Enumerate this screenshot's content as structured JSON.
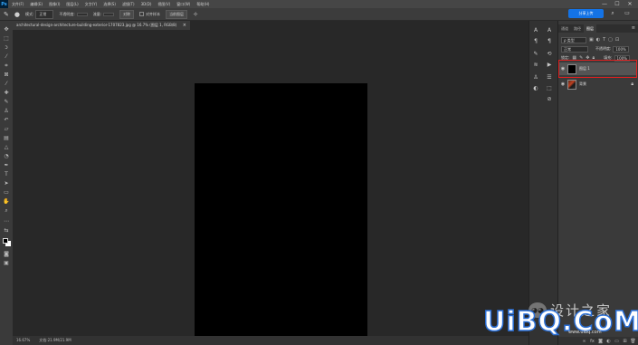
{
  "app": {
    "logo": "Ps",
    "menus": [
      "文件(F)",
      "编辑(E)",
      "图像(I)",
      "图层(L)",
      "文字(Y)",
      "选择(S)",
      "滤镜(T)",
      "3D(D)",
      "视图(V)",
      "窗口(W)",
      "帮助(H)"
    ],
    "window_controls": [
      "—",
      "☐",
      "✕"
    ]
  },
  "options_bar": {
    "mode_label": "模式:",
    "mode_value": "正常",
    "opacity_label": "不透明度:",
    "flow_label": "流量:",
    "symmetry_button": "对称",
    "align_label": "对齐样本",
    "sample_button": "当前图层",
    "share_button": "分享上传"
  },
  "document_tab": {
    "title": "architectural-design-architecture-building-exterior-1707823.jpg @ 16.7% (图层 1, RGB/8)",
    "close": "×"
  },
  "status_bar": {
    "zoom": "16.67%",
    "doc_info": "文档:21.9M/21.9M"
  },
  "colors": {
    "foreground": "#000000",
    "background": "#ffffff",
    "highlight": "#e02020",
    "accent": "#1473e6"
  },
  "layers_panel": {
    "tabs": [
      "通道",
      "路径",
      "图层"
    ],
    "active_tab": "图层",
    "filter_label": "ρ 类型",
    "blend_mode": "正常",
    "opacity_label": "不透明度:",
    "opacity_value": "100%",
    "lock_label": "锁定:",
    "fill_label": "填充:",
    "fill_value": "100%",
    "layers": [
      {
        "name": "图层 1",
        "selected": true
      },
      {
        "name": "背景",
        "selected": false
      }
    ]
  },
  "watermark": {
    "cn_text": "设计之家",
    "logo_text": "UiBQ.CoM",
    "url": "www.uibq.com"
  }
}
